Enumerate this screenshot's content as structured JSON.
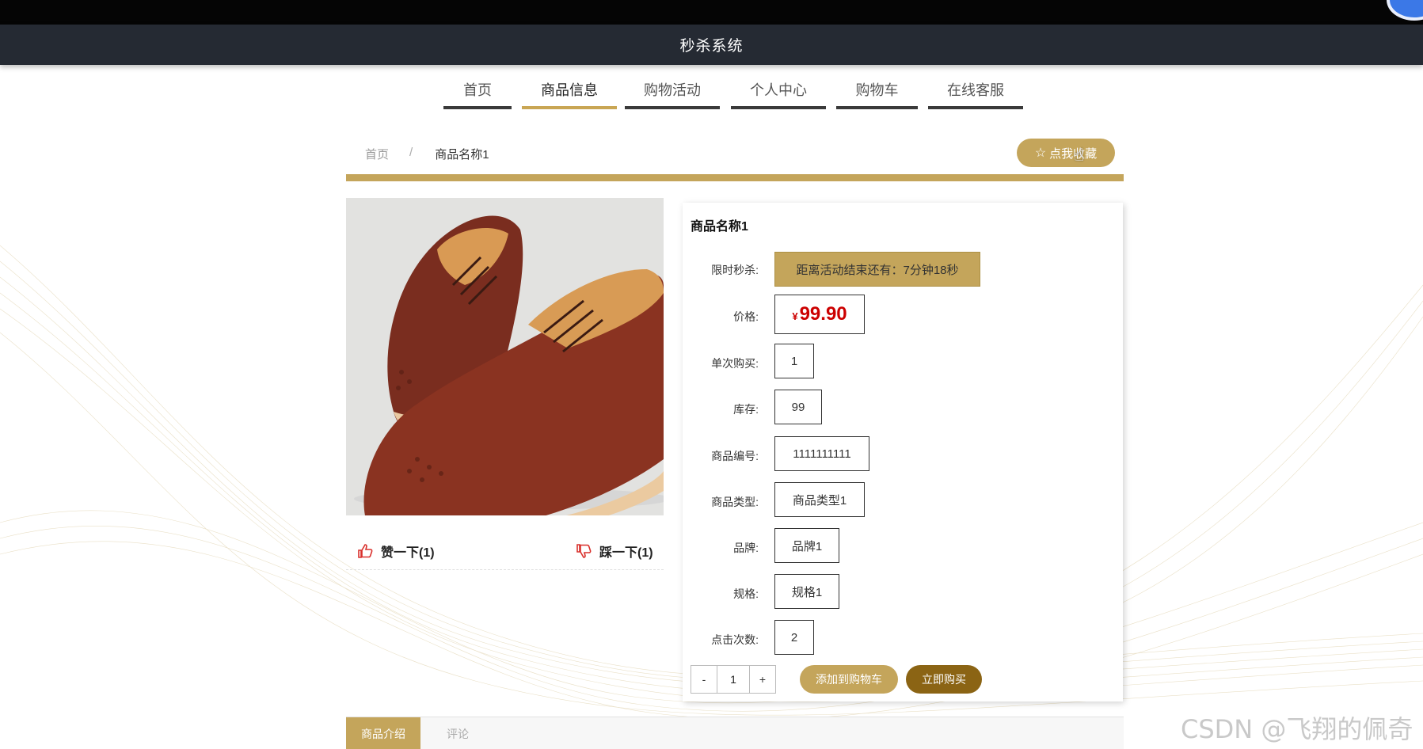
{
  "header": {
    "title": "秒杀系统"
  },
  "nav": {
    "items": [
      {
        "label": "首页"
      },
      {
        "label": "商品信息"
      },
      {
        "label": "购物活动"
      },
      {
        "label": "个人中心"
      },
      {
        "label": "购物车"
      },
      {
        "label": "在线客服"
      }
    ],
    "active_index": 1
  },
  "breadcrumb": {
    "home": "首页",
    "separator": "/",
    "current": "商品名称1"
  },
  "favorite_button": {
    "label": "点我收藏",
    "icon": "star-icon"
  },
  "product": {
    "name": "商品名称1",
    "flash_label": "限时秒杀:",
    "flash_text": "距离活动结束还有：7分钟18秒",
    "price_label": "价格:",
    "price_currency": "¥",
    "price_value": "99.90",
    "single_purchase_label": "单次购买:",
    "single_purchase": "1",
    "stock_label": "库存:",
    "stock": "99",
    "code_label": "商品编号:",
    "code": "1111111111",
    "type_label": "商品类型:",
    "type": "商品类型1",
    "brand_label": "品牌:",
    "brand": "品牌1",
    "spec_label": "规格:",
    "spec": "规格1",
    "clicks_label": "点击次数:",
    "clicks": "2"
  },
  "votes": {
    "like": "赞一下(1)",
    "dislike": "踩一下(1)"
  },
  "quantity": {
    "minus": "-",
    "value": "1",
    "plus": "+"
  },
  "actions": {
    "add_to_cart": "添加到购物车",
    "buy_now": "立即购买"
  },
  "tabs": [
    {
      "label": "商品介绍"
    },
    {
      "label": "评论"
    }
  ],
  "watermark": "CSDN @飞翔的佩奇",
  "colors": {
    "accent_gold": "#c4a55b",
    "header_bg": "#252a33",
    "price_red": "#cc0000",
    "buy_dark": "#8b6414"
  }
}
